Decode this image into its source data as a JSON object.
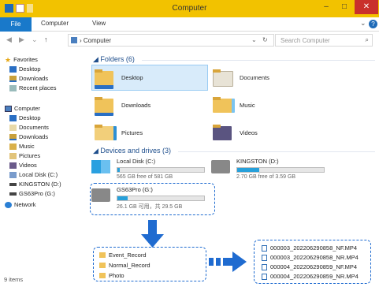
{
  "window": {
    "title": "Computer"
  },
  "ribbon": {
    "tabs": [
      "File",
      "Computer",
      "View"
    ]
  },
  "address": {
    "crumb": "Computer",
    "search_placeholder": "Search Computer"
  },
  "nav": {
    "favorites": "Favorites",
    "fav_items": [
      "Desktop",
      "Downloads",
      "Recent places"
    ],
    "computer": "Computer",
    "computer_items": [
      "Desktop",
      "Documents",
      "Downloads",
      "Music",
      "Pictures",
      "Videos",
      "Local Disk (C:)",
      "KINGSTON (D:)",
      "GS63Pro (G:)"
    ],
    "network": "Network"
  },
  "folders": {
    "header": "Folders (6)",
    "items": [
      "Desktop",
      "Documents",
      "Downloads",
      "Music",
      "Pictures",
      "Videos"
    ]
  },
  "drives": {
    "header": "Devices and drives (3)",
    "items": [
      {
        "name": "Local Disk (C:)",
        "info": "565 GB free of 581 GB",
        "used_fraction": 0.03
      },
      {
        "name": "KINGSTON (D:)",
        "info": "2.70 GB free of 3.59 GB",
        "used_fraction": 0.25
      },
      {
        "name": "GS63Pro (G:)",
        "info": "26.1 GB 可用，共 29.5 GB",
        "used_fraction": 0.12
      }
    ]
  },
  "callouts": {
    "folders": [
      "Event_Record",
      "Normal_Record",
      "Photo"
    ],
    "files": [
      "000003_202206290858_NF.MP4",
      "000003_202206290858_NR.MP4",
      "000004_202206290859_NF.MP4",
      "000004_202206290859_NR.MP4"
    ]
  },
  "status": {
    "items": "9 items"
  },
  "colors": {
    "titlebar": "#f2c200",
    "accent": "#1979ca",
    "annotation": "#1f6bd0"
  }
}
